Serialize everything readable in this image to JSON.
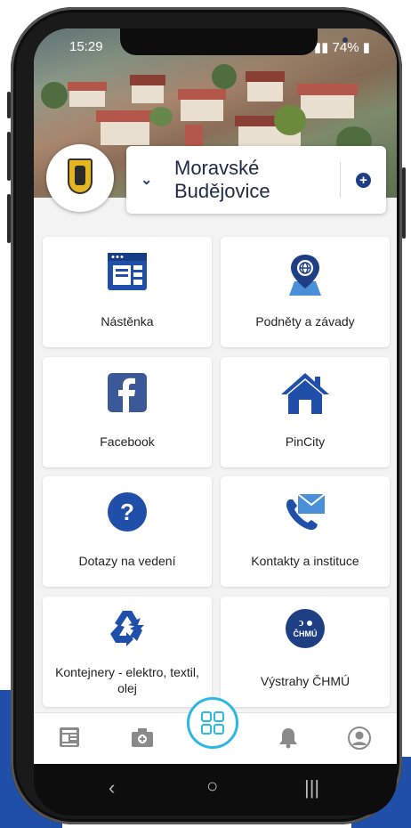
{
  "status_bar": {
    "time": "15:29",
    "battery": "74%"
  },
  "city": {
    "name": "Moravské Budějovice"
  },
  "tiles": [
    {
      "label": "Nástěnka",
      "icon": "bulletin-board-icon"
    },
    {
      "label": "Podněty a závady",
      "icon": "map-pin-globe-icon"
    },
    {
      "label": "Facebook",
      "icon": "facebook-icon"
    },
    {
      "label": "PinCity",
      "icon": "house-icon"
    },
    {
      "label": "Dotazy na vedení",
      "icon": "question-icon"
    },
    {
      "label": "Kontakty a instituce",
      "icon": "phone-envelope-icon"
    },
    {
      "label": "Kontejnery - elektro, textil, olej",
      "icon": "recycle-icon"
    },
    {
      "label": "Výstrahy ČHMÚ",
      "icon": "chmu-icon"
    }
  ],
  "chmu_badge": "ČHMÚ",
  "bottom_nav": [
    {
      "name": "news-icon"
    },
    {
      "name": "camera-icon"
    },
    {
      "name": "grid-icon"
    },
    {
      "name": "bell-icon"
    },
    {
      "name": "profile-icon"
    }
  ],
  "colors": {
    "accent": "#1f3f85",
    "highlight": "#2cb8e0",
    "brand_blue": "#1f4fa8"
  }
}
